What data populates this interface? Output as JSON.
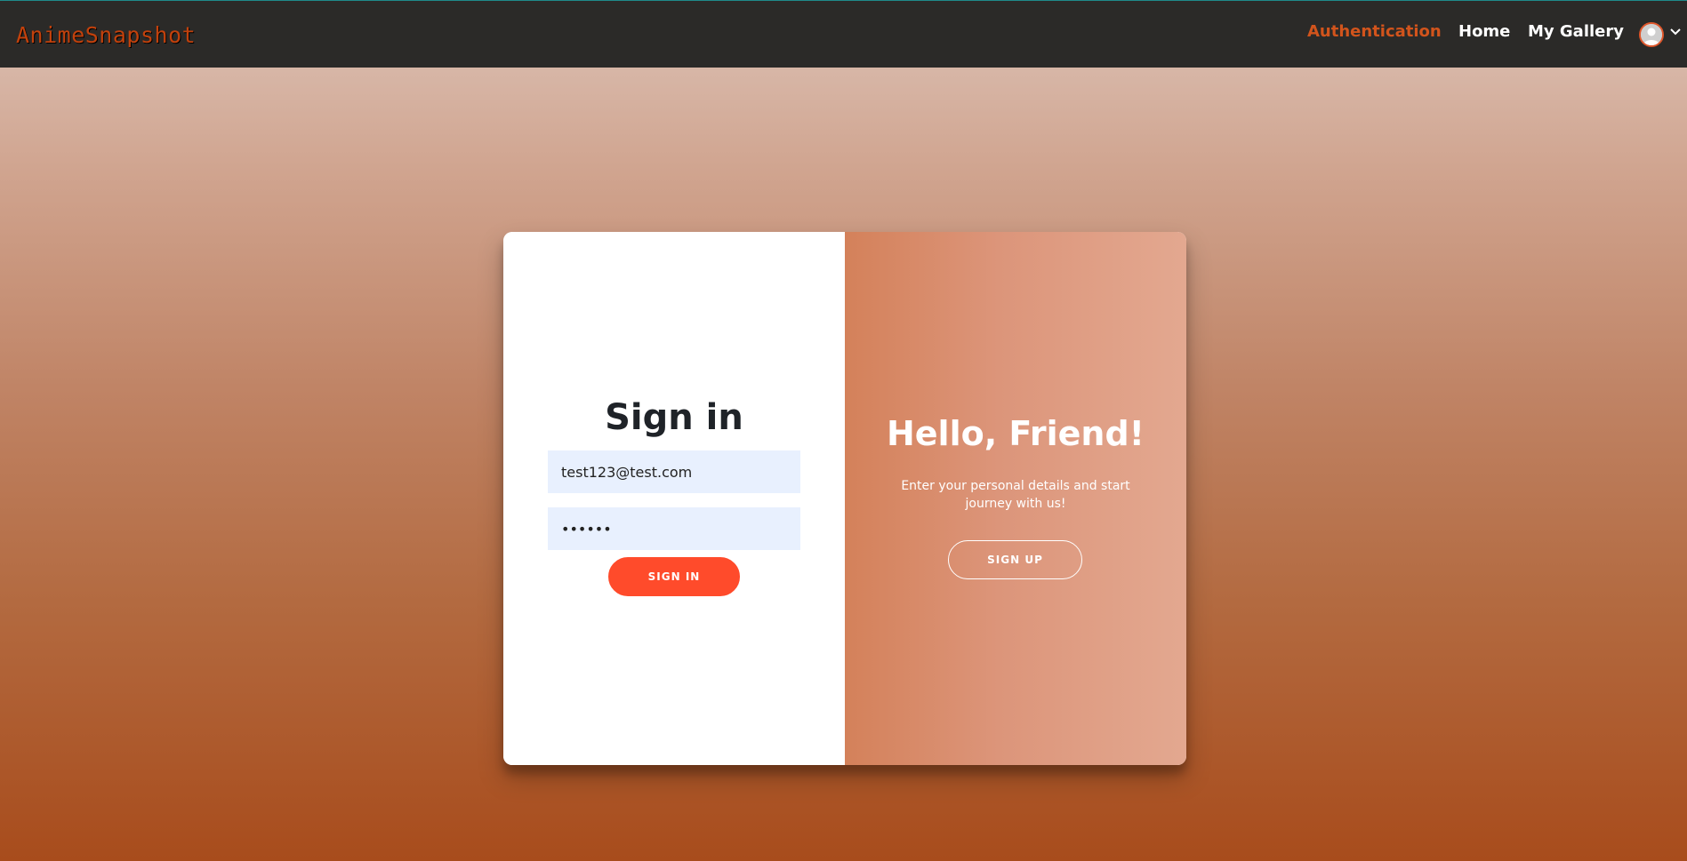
{
  "navbar": {
    "brand": "AnimeSnapshot",
    "links": {
      "authentication": "Authentication",
      "home": "Home",
      "gallery": "My Gallery"
    },
    "active_color": "#d2541c"
  },
  "signin": {
    "title": "Sign in",
    "email_value": "test123@test.com",
    "password_value": "••••••",
    "button_label": "SIGN IN",
    "button_color": "#ff4b2b"
  },
  "overlay": {
    "title": "Hello, Friend!",
    "text": "Enter your personal details and start journey with us!",
    "button_label": "SIGN UP"
  }
}
